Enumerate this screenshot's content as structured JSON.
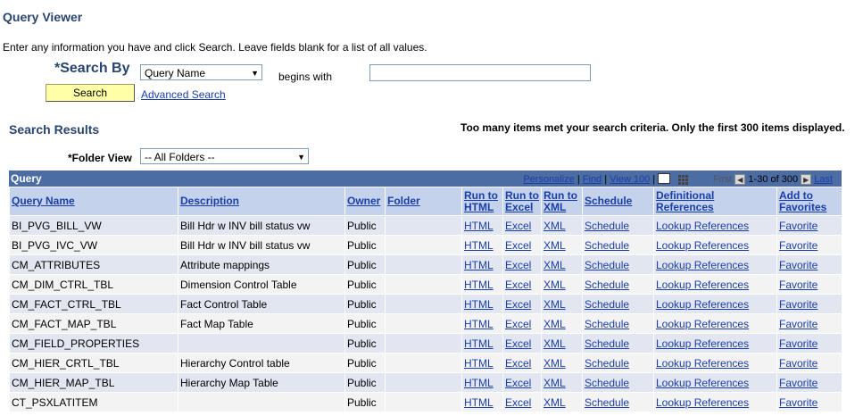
{
  "page_title": "Query Viewer",
  "instructions": "Enter any information you have and click Search. Leave fields blank for a list of all values.",
  "search": {
    "search_by_label": "*Search By",
    "search_by_value": "Query Name",
    "operator": "begins with",
    "input_value": "",
    "search_button": "Search",
    "advanced_link": "Advanced Search"
  },
  "results": {
    "heading": "Search Results",
    "message": "Too many items met your search criteria. Only the first 300 items displayed.",
    "folder_view_label": "*Folder View",
    "folder_view_value": "-- All Folders --"
  },
  "grid": {
    "title": "Query",
    "personalize": "Personalize",
    "find": "Find",
    "view": "View 100",
    "first": "First",
    "range": "1-30 of 300",
    "last": "Last",
    "headers": {
      "query_name": "Query Name",
      "description": "Description",
      "owner": "Owner",
      "folder": "Folder",
      "run_html": "Run to HTML",
      "run_excel": "Run to Excel",
      "run_xml": "Run to XML",
      "schedule": "Schedule",
      "definitional": "Definitional References",
      "add_fav": "Add to Favorites"
    },
    "rows": [
      {
        "name": "BI_PVG_BILL_VW",
        "desc": "Bill Hdr w INV bill status vw",
        "owner": "Public",
        "folder": "",
        "html": "HTML",
        "excel": "Excel",
        "xml": "XML",
        "schedule": "Schedule",
        "refs": "Lookup References",
        "fav": "Favorite"
      },
      {
        "name": "BI_PVG_IVC_VW",
        "desc": "Bill Hdr w INV bill status vw",
        "owner": "Public",
        "folder": "",
        "html": "HTML",
        "excel": "Excel",
        "xml": "XML",
        "schedule": "Schedule",
        "refs": "Lookup References",
        "fav": "Favorite"
      },
      {
        "name": "CM_ATTRIBUTES",
        "desc": "Attribute mappings",
        "owner": "Public",
        "folder": "",
        "html": "HTML",
        "excel": "Excel",
        "xml": "XML",
        "schedule": "Schedule",
        "refs": "Lookup References",
        "fav": "Favorite"
      },
      {
        "name": "CM_DIM_CTRL_TBL",
        "desc": "Dimension Control Table",
        "owner": "Public",
        "folder": "",
        "html": "HTML",
        "excel": "Excel",
        "xml": "XML",
        "schedule": "Schedule",
        "refs": "Lookup References",
        "fav": "Favorite"
      },
      {
        "name": "CM_FACT_CTRL_TBL",
        "desc": "Fact Control Table",
        "owner": "Public",
        "folder": "",
        "html": "HTML",
        "excel": "Excel",
        "xml": "XML",
        "schedule": "Schedule",
        "refs": "Lookup References",
        "fav": "Favorite"
      },
      {
        "name": "CM_FACT_MAP_TBL",
        "desc": "Fact Map Table",
        "owner": "Public",
        "folder": "",
        "html": "HTML",
        "excel": "Excel",
        "xml": "XML",
        "schedule": "Schedule",
        "refs": "Lookup References",
        "fav": "Favorite"
      },
      {
        "name": "CM_FIELD_PROPERTIES",
        "desc": "",
        "owner": "Public",
        "folder": "",
        "html": "HTML",
        "excel": "Excel",
        "xml": "XML",
        "schedule": "Schedule",
        "refs": "Lookup References",
        "fav": "Favorite"
      },
      {
        "name": "CM_HIER_CRTL_TBL",
        "desc": "Hierarchy Control table",
        "owner": "Public",
        "folder": "",
        "html": "HTML",
        "excel": "Excel",
        "xml": "XML",
        "schedule": "Schedule",
        "refs": "Lookup References",
        "fav": "Favorite"
      },
      {
        "name": "CM_HIER_MAP_TBL",
        "desc": "Hierarchy Map Table",
        "owner": "Public",
        "folder": "",
        "html": "HTML",
        "excel": "Excel",
        "xml": "XML",
        "schedule": "Schedule",
        "refs": "Lookup References",
        "fav": "Favorite"
      },
      {
        "name": "CT_PSXLATITEM",
        "desc": "",
        "owner": "Public",
        "folder": "",
        "html": "HTML",
        "excel": "Excel",
        "xml": "XML",
        "schedule": "Schedule",
        "refs": "Lookup References",
        "fav": "Favorite"
      }
    ]
  },
  "colors": {
    "heading": "#29456f",
    "grid_header": "#4c6da3",
    "column_header": "#c4d2eb",
    "row_odd": "#e2e6f0",
    "row_even": "#f3f3f3",
    "button": "#ffffa8",
    "link": "#1a3ea8"
  }
}
